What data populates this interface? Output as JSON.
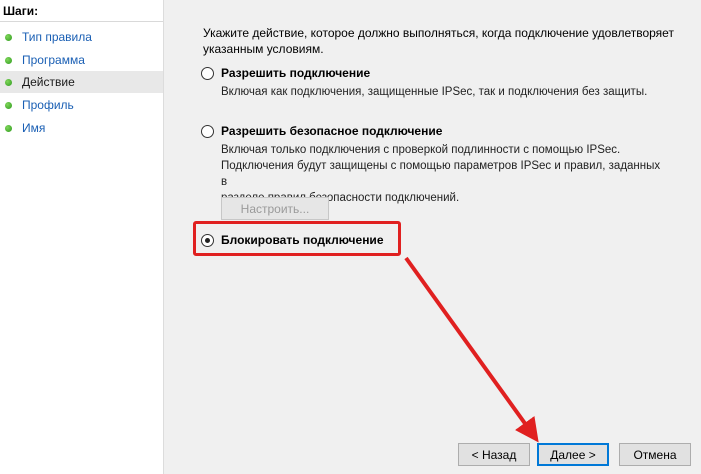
{
  "sidebar": {
    "title": "Шаги:",
    "steps": [
      {
        "label": "Тип правила"
      },
      {
        "label": "Программа"
      },
      {
        "label": "Действие"
      },
      {
        "label": "Профиль"
      },
      {
        "label": "Имя"
      }
    ]
  },
  "main": {
    "description": "Укажите действие, которое должно выполняться, когда подключение удовлетворяет указанным условиям.",
    "options": [
      {
        "label": "Разрешить подключение",
        "description": "Включая как подключения, защищенные IPSec, так и подключения без защиты."
      },
      {
        "label": "Разрешить безопасное подключение",
        "description_lines": [
          "Включая только подключения с проверкой подлинности с помощью IPSec.",
          "Подключения будут защищены с помощью параметров IPSec и правил, заданных в",
          "разделе правил безопасности подключений."
        ]
      },
      {
        "label": "Блокировать подключение"
      }
    ],
    "selected_option": "Блокировать подключение",
    "configure_button": "Настроить..."
  },
  "footer": {
    "back_button": "< Назад",
    "next_button": "Далее >",
    "cancel_button": "Отмена"
  },
  "colors": {
    "annotation": "#e02020",
    "link": "#1a5fb4",
    "focus": "#0078d7"
  }
}
